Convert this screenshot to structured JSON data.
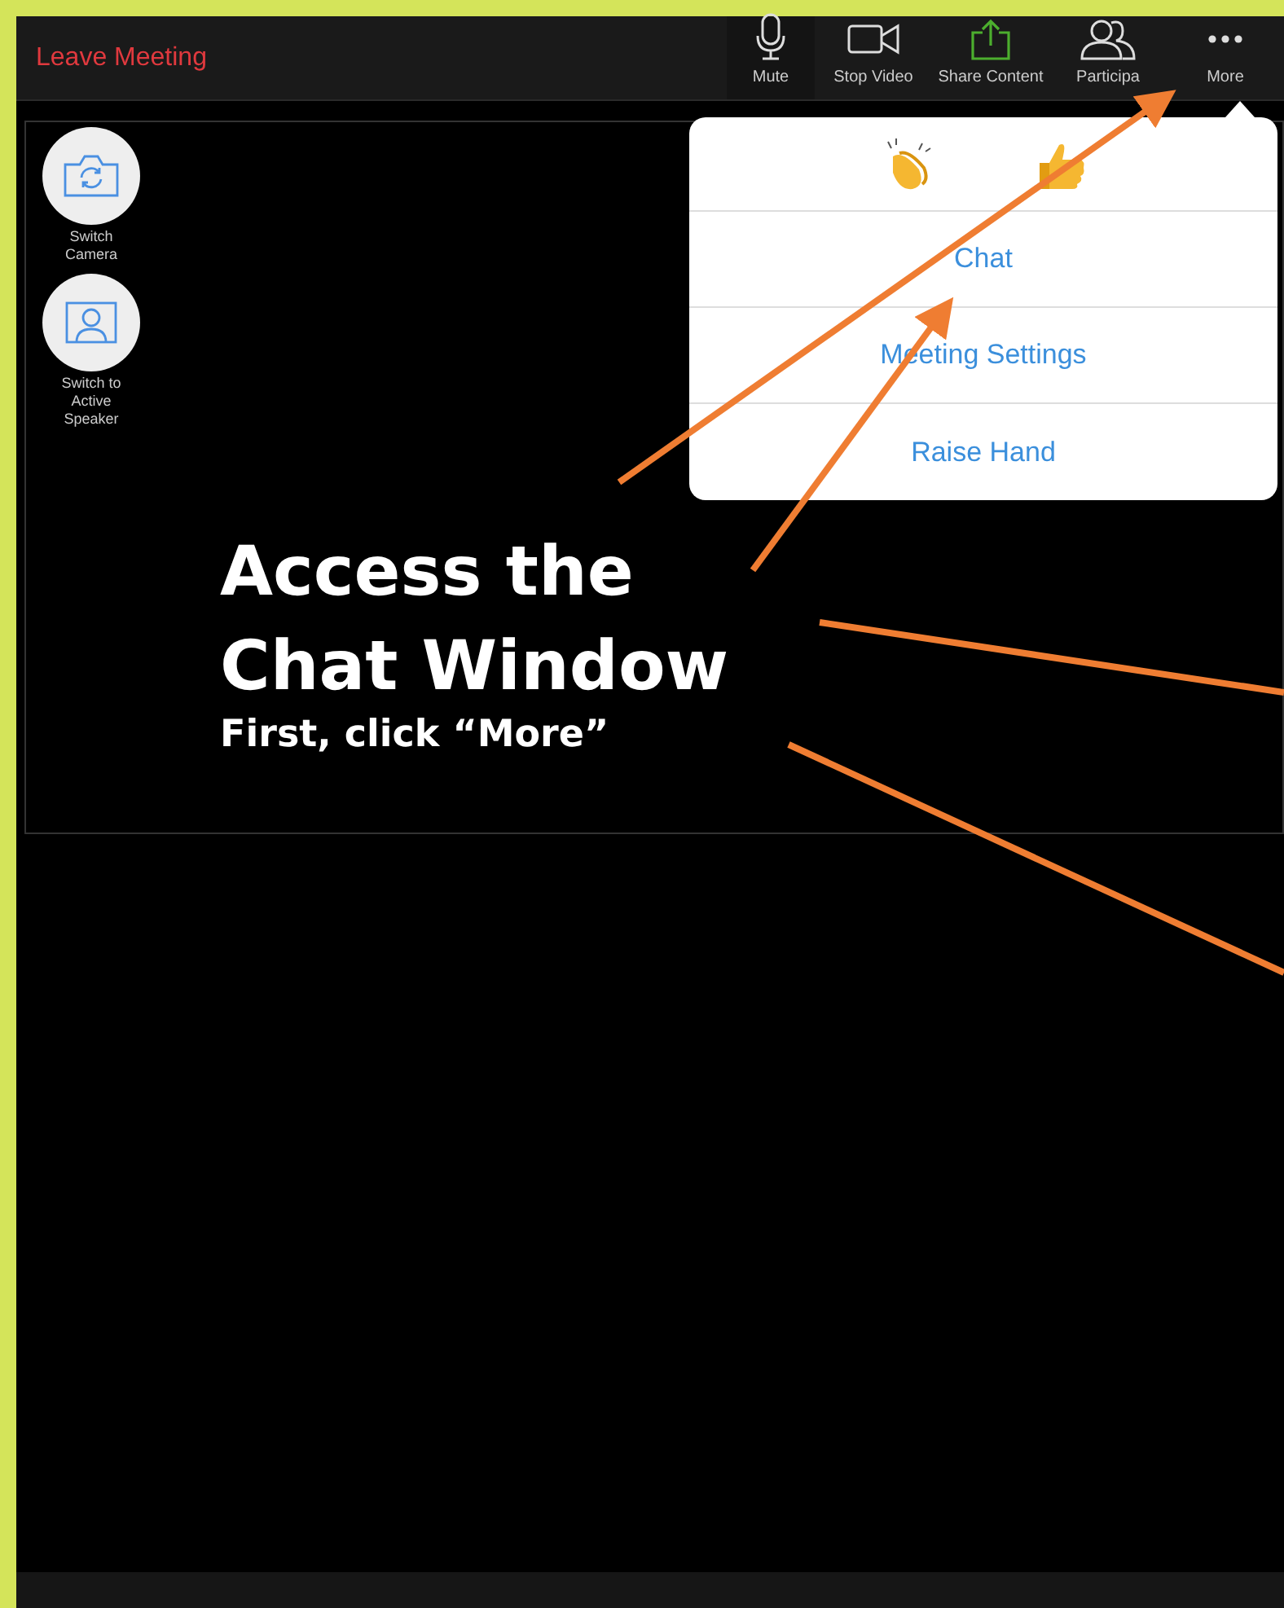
{
  "toolbar": {
    "leave": "Leave Meeting",
    "buttons": [
      {
        "label": "Mute",
        "kind": "mic"
      },
      {
        "label": "Stop Video",
        "kind": "video"
      },
      {
        "label": "Share Content",
        "kind": "share"
      },
      {
        "label": "Participa",
        "kind": "people"
      },
      {
        "label": "More",
        "kind": "more"
      }
    ]
  },
  "side_controls": [
    {
      "label": "Switch Camera",
      "kind": "camera"
    },
    {
      "label": "Switch to Active Speaker",
      "kind": "speaker"
    }
  ],
  "more_menu": {
    "reactions": [
      {
        "kind": "clap"
      },
      {
        "kind": "thumbs"
      }
    ],
    "items": [
      "Chat",
      "Meeting Settings",
      "Raise Hand"
    ]
  },
  "annotation": {
    "title_lines": [
      "Access the",
      "Chat Window"
    ],
    "subtitle": "First, click “More”"
  }
}
